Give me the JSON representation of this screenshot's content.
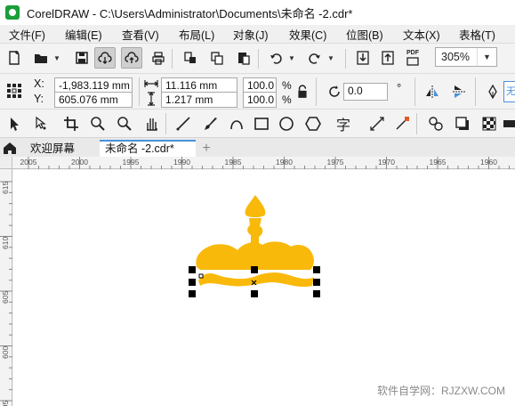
{
  "window": {
    "title": "CorelDRAW - C:\\Users\\Administrator\\Documents\\未命名 -2.cdr*"
  },
  "menu": [
    "文件(F)",
    "编辑(E)",
    "查看(V)",
    "布局(L)",
    "对象(J)",
    "效果(C)",
    "位图(B)",
    "文本(X)",
    "表格(T)"
  ],
  "toolbar_standard": {
    "zoom_value": "305%",
    "pdf_label": "PDF"
  },
  "property_bar": {
    "x_label": "X:",
    "y_label": "Y:",
    "x_value": "-1,983.119 mm",
    "y_value": "605.076 mm",
    "width_value": "11.116 mm",
    "height_value": "1.217 mm",
    "scale_x": "100.0",
    "scale_y": "100.0",
    "percent": "%",
    "rotation_value": "0.0",
    "degree": "°",
    "text_tool_glyph": "字"
  },
  "tabs": {
    "welcome": "欢迎屏幕",
    "document": "未命名 -2.cdr*",
    "add": "+"
  },
  "ruler": {
    "h_labels": [
      "2005",
      "2000",
      "1995",
      "1990",
      "1985",
      "1980",
      "1975",
      "1970",
      "1965",
      "1960"
    ],
    "v_labels": [
      "615",
      "610",
      "605",
      "600",
      "595"
    ]
  },
  "drawing": {
    "fill_color": "#F9B90A"
  },
  "colors": {
    "selection_handle": "#000000",
    "active_tab_accent": "#4A90D9"
  },
  "watermark": "软件自学网：RJZXW.COM"
}
